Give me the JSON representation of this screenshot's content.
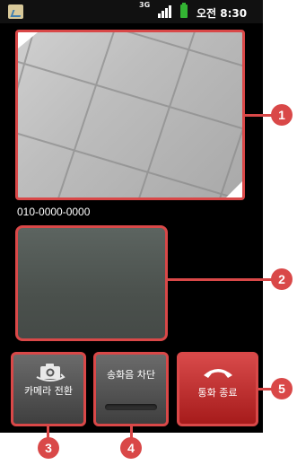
{
  "status_bar": {
    "network": "3G",
    "time": "오전 8:30"
  },
  "call": {
    "phone_number": "010-0000-0000"
  },
  "buttons": {
    "camera_switch": "카메라 전환",
    "mute": "송화음 차단",
    "end_call": "통화 종료"
  },
  "callouts": [
    "1",
    "2",
    "3",
    "4",
    "5"
  ],
  "colors": {
    "callout": "#d94848",
    "end_call": "#c23232",
    "battery": "#33b433"
  }
}
